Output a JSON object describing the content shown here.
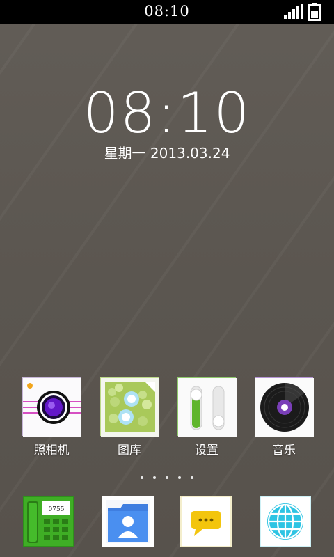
{
  "status_bar": {
    "time": "08:10",
    "signal_icon": "signal-bars-icon",
    "battery_icon": "battery-icon"
  },
  "lockscreen": {
    "clock": "08:10",
    "date": "星期一 2013.03.24"
  },
  "apps": [
    {
      "label": "照相机",
      "icon": "camera-icon"
    },
    {
      "label": "图库",
      "icon": "gallery-icon"
    },
    {
      "label": "设置",
      "icon": "settings-icon"
    },
    {
      "label": "音乐",
      "icon": "music-icon"
    }
  ],
  "page_indicator": {
    "count": 5
  },
  "dock": [
    {
      "icon": "phone-icon",
      "number_text": "0755"
    },
    {
      "icon": "contacts-icon"
    },
    {
      "icon": "messages-icon"
    },
    {
      "icon": "browser-icon"
    }
  ],
  "colors": {
    "status_bar": "#000000",
    "wallpaper": "#5d5852",
    "text": "#ffffff"
  }
}
